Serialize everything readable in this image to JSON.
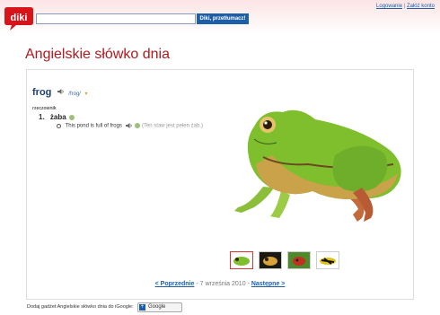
{
  "header": {
    "search_placeholder": "",
    "search_button": "Diki, przetłumacz!",
    "login_link": "Logowanie",
    "separator": "|",
    "register_link": "Załóż konto"
  },
  "page_title": "Angielskie słówko dnia",
  "entry": {
    "headword": "frog",
    "pronunciation": "/frog/",
    "more_marker": "▾",
    "part_of_speech": "rzeczownik",
    "meaning_number": "1.",
    "meaning": "żaba",
    "example": "This pond is full of frogs",
    "example_translation": "(Ten staw jest pełen żab.)"
  },
  "nav": {
    "prev": "< Poprzednie",
    "date": "- 7 września 2010 -",
    "next": "Następne >"
  },
  "footer": {
    "gadget_text": "Dodaj gadżet Angielskie słówko dnia do iGoogle:",
    "igoogle_plus": "+",
    "igoogle_label": "Google"
  },
  "icons": {
    "speaker": "speaker-icon",
    "plus": "plus-circle-icon"
  },
  "colors": {
    "brand_red": "#b0191e",
    "link_blue": "#1c5fa8",
    "headword_blue": "#1d3f73"
  }
}
